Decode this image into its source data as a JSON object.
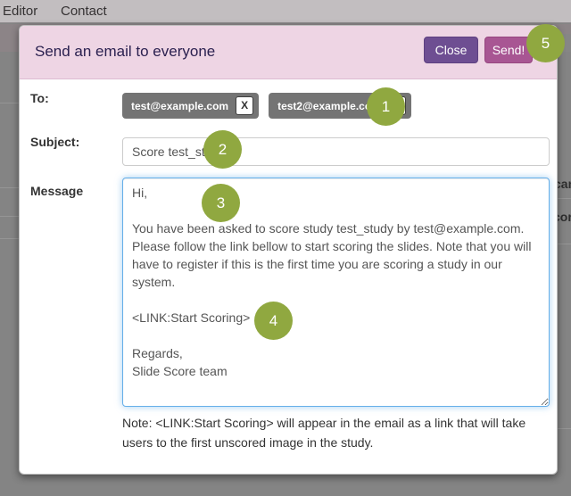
{
  "nav": {
    "items": [
      {
        "label": "Editor"
      },
      {
        "label": "Contact"
      }
    ]
  },
  "background_page": {
    "partial_text_1": "can",
    "partial_text_2": "core"
  },
  "modal": {
    "title": "Send an email to everyone",
    "buttons": {
      "close": "Close",
      "send": "Send!"
    },
    "fields": {
      "to": {
        "label": "To:",
        "recipients": [
          {
            "email": "test@example.com",
            "remove": "X"
          },
          {
            "email": "test2@example.com",
            "remove": "X"
          }
        ]
      },
      "subject": {
        "label": "Subject:",
        "value": "Score test_study"
      },
      "message": {
        "label": "Message",
        "value": "Hi,\n\nYou have been asked to score study test_study by test@example.com. Please follow the link bellow to start scoring the slides. Note that you will have to register if this is the first time you are scoring a study in our system.\n\n<LINK:Start Scoring>\n\nRegards,\nSlide Score team"
      }
    },
    "note": "Note: <LINK:Start Scoring> will appear in the email as a link that will take users to the first unscored image in the study."
  },
  "annotations": {
    "step1": "1",
    "step2": "2",
    "step3": "3",
    "step4": "4",
    "step5": "5"
  },
  "colors": {
    "modal_header_pink": "#eed5e4",
    "title_text": "#2b2150",
    "close_button_purple": "#6e4e92",
    "send_button_magenta": "#a85693",
    "annotation_green": "#90a840",
    "recipient_chip_gray": "#747474",
    "textarea_focus_blue": "#66afe9",
    "backdrop_gray": "#848484"
  }
}
